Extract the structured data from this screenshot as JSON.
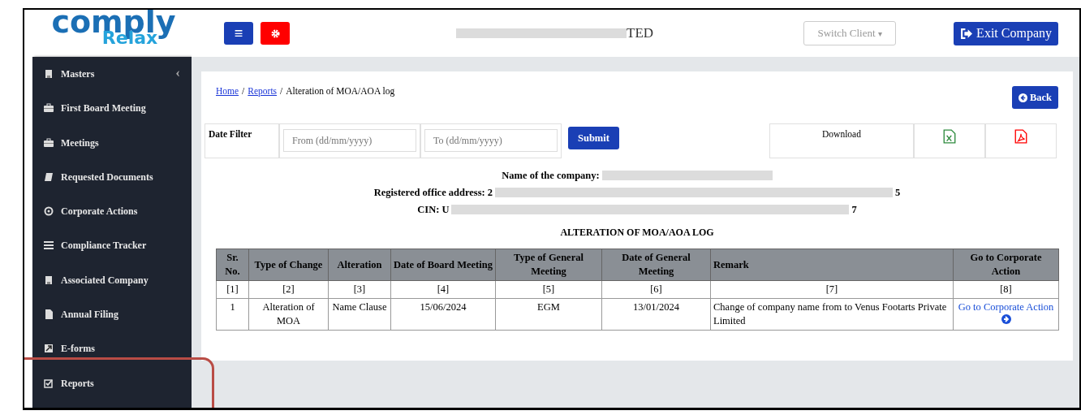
{
  "logo": {
    "word": "comply",
    "sub": "Relax"
  },
  "header": {
    "menu_button": "≡",
    "company_visible": "TED",
    "switch_client": "Switch Client",
    "switch_caret": "▾",
    "exit_button": "Exit Company"
  },
  "sidebar": {
    "items": [
      {
        "label": "Masters",
        "chevron": "‹"
      },
      {
        "label": "First Board Meeting"
      },
      {
        "label": "Meetings"
      },
      {
        "label": "Requested Documents"
      },
      {
        "label": "Corporate Actions"
      },
      {
        "label": "Compliance Tracker"
      },
      {
        "label": "Associated Company"
      },
      {
        "label": "Annual Filing"
      },
      {
        "label": "E-forms"
      },
      {
        "label": "Reports",
        "highlighted": true
      }
    ]
  },
  "breadcrumb": {
    "separator": "/",
    "items": [
      {
        "label": "Home",
        "link": true
      },
      {
        "label": "Reports",
        "link": true
      },
      {
        "label": "Alteration of MOA/AOA log",
        "link": false
      }
    ]
  },
  "back_button": "Back",
  "filter": {
    "label": "Date Filter",
    "from": {
      "placeholder": "From (dd/mm/yyyy)"
    },
    "to": {
      "placeholder": "To (dd/mm/yyyy)"
    },
    "submit": "Submit",
    "download": "Download"
  },
  "company_info": [
    {
      "label": "Name of the company:"
    },
    {
      "label": "Registered office address:",
      "before": "2",
      "after": "5"
    },
    {
      "label": "CIN:",
      "before": "U",
      "after": "7"
    }
  ],
  "report_title": "ALTERATION OF MOA/AOA LOG",
  "table": {
    "columns": [
      {
        "label": "Sr. No.",
        "index": "[1]"
      },
      {
        "label": "Type of Change",
        "index": "[2]"
      },
      {
        "label": "Alteration",
        "index": "[3]"
      },
      {
        "label": "Date of Board Meeting",
        "index": "[4]"
      },
      {
        "label": "Type of General Meeting",
        "index": "[5]"
      },
      {
        "label": "Date of General Meeting",
        "index": "[6]"
      },
      {
        "label": "Remark",
        "index": "[7]"
      },
      {
        "label": "Go to Corporate Action",
        "index": "[8]"
      }
    ],
    "rows": [
      {
        "cells": [
          {
            "text": "1"
          },
          {
            "text": "Alteration of MOA"
          },
          {
            "text": "Name Clause"
          },
          {
            "text": "15/06/2024"
          },
          {
            "text": "EGM"
          },
          {
            "text": "13/01/2024"
          },
          {
            "text": "Change of company name from to Venus Footarts Private Limited"
          },
          {
            "text": "Go to Corporate Action",
            "kind": "link"
          }
        ]
      }
    ]
  }
}
